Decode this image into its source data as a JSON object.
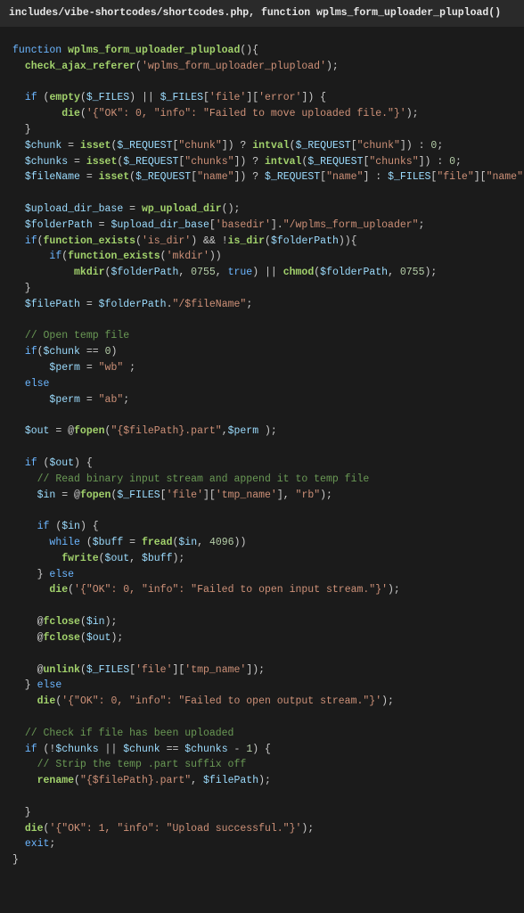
{
  "header": "includes/vibe-shortcodes/shortcodes.php, function wplms_form_uploader_plupload()",
  "code": {
    "l1_kw": "function",
    "l1_fn": "wplms_form_uploader_plupload",
    "l2_fn": "check_ajax_referer",
    "l2_str": "'wplms_form_uploader_plupload'",
    "l4_if": "if",
    "l4_fn1": "empty",
    "l4_var1": "$_FILES",
    "l4_var2": "$_FILES",
    "l4_str1": "'file'",
    "l4_str2": "'error'",
    "l5_fn": "die",
    "l5_str": "'{\"OK\": 0, \"info\": \"Failed to move uploaded file.\"}'",
    "l7_var": "$chunk",
    "l7_fn1": "isset",
    "l7_var2": "$_REQUEST",
    "l7_str1": "\"chunk\"",
    "l7_fn2": "intval",
    "l7_var3": "$_REQUEST",
    "l7_str2": "\"chunk\"",
    "l7_num": "0",
    "l8_var": "$chunks",
    "l8_fn1": "isset",
    "l8_var2": "$_REQUEST",
    "l8_str1": "\"chunks\"",
    "l8_fn2": "intval",
    "l8_var3": "$_REQUEST",
    "l8_str2": "\"chunks\"",
    "l8_num": "0",
    "l9_var": "$fileName",
    "l9_fn1": "isset",
    "l9_var2": "$_REQUEST",
    "l9_str1": "\"name\"",
    "l9_var3": "$_REQUEST",
    "l9_str2": "\"name\"",
    "l9_var4": "$_FILES",
    "l9_str3": "\"file\"",
    "l9_str4": "\"name\"",
    "l11_var": "$upload_dir_base",
    "l11_fn": "wp_upload_dir",
    "l12_var1": "$folderPath",
    "l12_var2": "$upload_dir_base",
    "l12_str1": "'basedir'",
    "l12_str2": "\"/wplms_form_uploader\"",
    "l13_if": "if",
    "l13_fn1": "function_exists",
    "l13_str1": "'is_dir'",
    "l13_fn2": "is_dir",
    "l13_var": "$folderPath",
    "l14_if": "if",
    "l14_fn1": "function_exists",
    "l14_str1": "'mkdir'",
    "l15_fn1": "mkdir",
    "l15_var1": "$folderPath",
    "l15_num1": "0755",
    "l15_true": "true",
    "l15_fn2": "chmod",
    "l15_var2": "$folderPath",
    "l15_num2": "0755",
    "l17_var1": "$filePath",
    "l17_var2": "$folderPath",
    "l17_str": "\"/$fileName\"",
    "l19_cmt": "// Open temp file",
    "l20_if": "if",
    "l20_var": "$chunk",
    "l20_num": "0",
    "l21_var": "$perm",
    "l21_str": "\"wb\"",
    "l22_else": "else",
    "l23_var": "$perm",
    "l23_str": "\"ab\"",
    "l25_var": "$out",
    "l25_fn": "fopen",
    "l25_str1": "\"{$filePath}.part\"",
    "l25_var2": "$perm",
    "l27_if": "if",
    "l27_var": "$out",
    "l28_cmt": "// Read binary input stream and append it to temp file",
    "l29_var": "$in",
    "l29_fn": "fopen",
    "l29_var2": "$_FILES",
    "l29_str1": "'file'",
    "l29_str2": "'tmp_name'",
    "l29_str3": "\"rb\"",
    "l31_if": "if",
    "l31_var": "$in",
    "l32_while": "while",
    "l32_var1": "$buff",
    "l32_fn": "fread",
    "l32_var2": "$in",
    "l32_num": "4096",
    "l33_fn": "fwrite",
    "l33_var1": "$out",
    "l33_var2": "$buff",
    "l34_else": "else",
    "l35_fn": "die",
    "l35_str": "'{\"OK\": 0, \"info\": \"Failed to open input stream.\"}'",
    "l37_fn": "fclose",
    "l37_var": "$in",
    "l38_fn": "fclose",
    "l38_var": "$out",
    "l40_fn": "unlink",
    "l40_var": "$_FILES",
    "l40_str1": "'file'",
    "l40_str2": "'tmp_name'",
    "l41_else": "else",
    "l42_fn": "die",
    "l42_str": "'{\"OK\": 0, \"info\": \"Failed to open output stream.\"}'",
    "l44_cmt": "// Check if file has been uploaded",
    "l45_if": "if",
    "l45_var1": "$chunks",
    "l45_var2": "$chunk",
    "l45_var3": "$chunks",
    "l45_num": "1",
    "l46_cmt": "// Strip the temp .part suffix off",
    "l47_fn": "rename",
    "l47_str1": "\"{$filePath}.part\"",
    "l47_var": "$filePath",
    "l50_fn": "die",
    "l50_str": "'{\"OK\": 1, \"info\": \"Upload successful.\"}'",
    "l51_exit": "exit"
  }
}
